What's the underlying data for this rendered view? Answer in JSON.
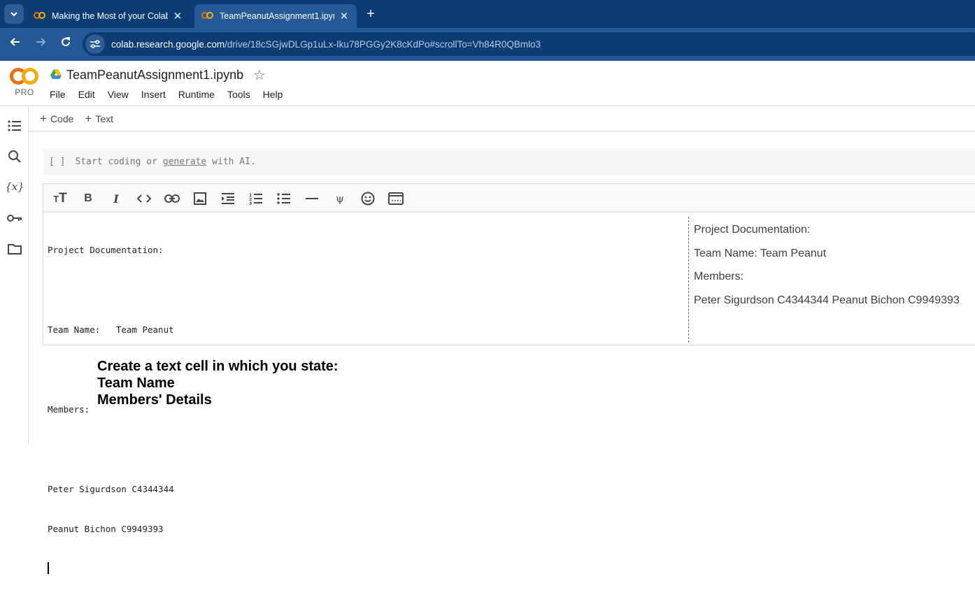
{
  "browser": {
    "tabs": [
      {
        "title": "Making the Most of your Colab",
        "active": false
      },
      {
        "title": "TeamPeanutAssignment1.ipynb",
        "active": true
      }
    ],
    "url_host": "colab.research.google.com",
    "url_path": "/drive/18cSGjwDLGp1uLx-Iku78PGGy2K8cKdPo#scrollTo=Vh84R0QBmlo3"
  },
  "colab": {
    "logo_badge": "PRO",
    "notebook_title": "TeamPeanutAssignment1.ipynb",
    "menu": [
      "File",
      "Edit",
      "View",
      "Insert",
      "Runtime",
      "Tools",
      "Help"
    ],
    "toolbar": {
      "add_code": "Code",
      "add_text": "Text"
    }
  },
  "code_cell": {
    "bracket": "[ ]",
    "placeholder_start": "Start coding or ",
    "placeholder_link": "generate",
    "placeholder_end": " with AI."
  },
  "text_cell": {
    "editor_lines": [
      "Project Documentation:",
      "",
      "Team Name:   Team Peanut",
      "",
      "Members:",
      "",
      "Peter Sigurdson C4344344",
      "Peanut Bichon C9949393"
    ],
    "preview": [
      "Project Documentation:",
      "Team Name: Team Peanut",
      "Members:",
      "Peter Sigurdson C4344344 Peanut Bichon C9949393"
    ]
  },
  "instructions": {
    "line1": "Create a text cell in which you state:",
    "line2": "Team Name",
    "line3": "Members' Details"
  }
}
